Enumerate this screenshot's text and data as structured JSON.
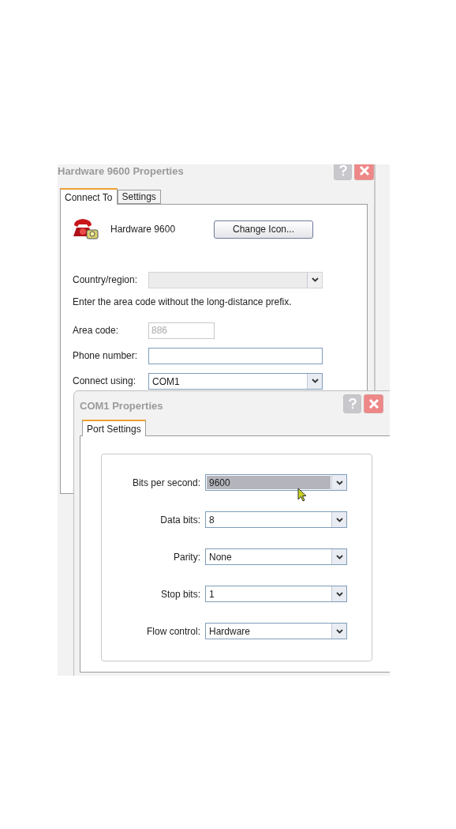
{
  "windows": [
    {
      "title": "Hardware 9600 Properties",
      "tabs": [
        {
          "label": "Connect To",
          "selected": true
        },
        {
          "label": "Settings",
          "selected": false
        }
      ],
      "connection_name": "Hardware 9600",
      "change_icon_button": "Change Icon...",
      "rows": [
        {
          "kind": "combo",
          "label": "Country/region:",
          "disabled": true
        },
        {
          "kind": "note",
          "label": "Enter the area code without the long-distance prefix."
        },
        {
          "kind": "text",
          "label": "Area code:",
          "value": "886",
          "disabled": true
        },
        {
          "kind": "text",
          "label": "Phone number:",
          "disabled": false
        },
        {
          "kind": "combo",
          "label": "Connect using:",
          "value": "COM1",
          "disabled": false
        }
      ]
    },
    {
      "title": "COM1 Properties",
      "tabs": [
        {
          "label": "Port Settings",
          "selected": true
        }
      ],
      "settings": [
        {
          "label": "Bits per second:",
          "value": "9600",
          "selected": true
        },
        {
          "label": "Data bits:",
          "value": "8",
          "selected": false
        },
        {
          "label": "Parity:",
          "value": "None",
          "selected": false
        },
        {
          "label": "Stop bits:",
          "value": "1",
          "selected": false
        },
        {
          "label": "Flow control:",
          "value": "Hardware",
          "selected": false
        }
      ]
    }
  ]
}
